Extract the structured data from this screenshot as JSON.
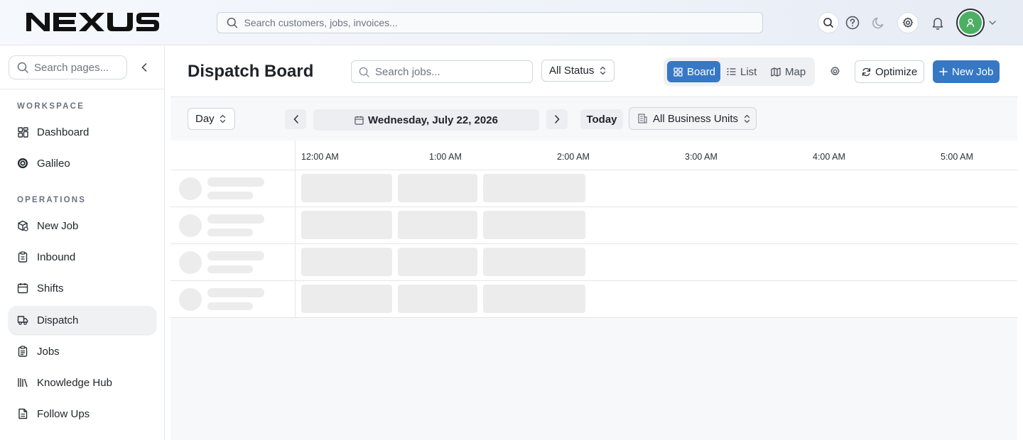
{
  "app": {
    "name": "NEXUS"
  },
  "topbar": {
    "search_placeholder": "Search customers, jobs, invoices...",
    "icons": [
      "search-icon",
      "help-icon",
      "moon-icon",
      "gear-icon",
      "bell-icon",
      "user-icon",
      "chevron-down-icon"
    ],
    "avatar_color": "#4caf63"
  },
  "sidebar": {
    "search_placeholder": "Search pages...",
    "sections": [
      {
        "label": "WORKSPACE"
      },
      {
        "label": "OPERATIONS"
      }
    ],
    "items": [
      {
        "label": "Dashboard",
        "icon": "grid-icon"
      },
      {
        "label": "Galileo",
        "icon": "galileo-icon"
      },
      {
        "label": "New Job",
        "icon": "box-icon"
      },
      {
        "label": "Inbound",
        "icon": "clipboard-icon"
      },
      {
        "label": "Shifts",
        "icon": "calendar-icon"
      },
      {
        "label": "Dispatch",
        "icon": "truck-icon",
        "active": true
      },
      {
        "label": "Jobs",
        "icon": "clipboard-list-icon"
      },
      {
        "label": "Knowledge Hub",
        "icon": "library-icon"
      },
      {
        "label": "Follow Ups",
        "icon": "file-icon"
      }
    ]
  },
  "main": {
    "title": "Dispatch Board",
    "job_search_placeholder": "Search jobs...",
    "status_select": "All Status",
    "views": [
      {
        "label": "Board",
        "icon": "grid-icon",
        "active": true
      },
      {
        "label": "List",
        "icon": "list-icon"
      },
      {
        "label": "Map",
        "icon": "map-icon"
      }
    ],
    "optimize_label": "Optimize",
    "new_job_label": "New Job",
    "accent_color": "#3778c4",
    "toolbar": {
      "range_select": "Day",
      "date": "Wednesday, July 22, 2026",
      "today_label": "Today",
      "business_unit_select": "All Business Units"
    },
    "hours": [
      "12:00 AM",
      "1:00 AM",
      "2:00 AM",
      "3:00 AM",
      "4:00 AM",
      "5:00 AM"
    ],
    "loading_rows": 4
  }
}
